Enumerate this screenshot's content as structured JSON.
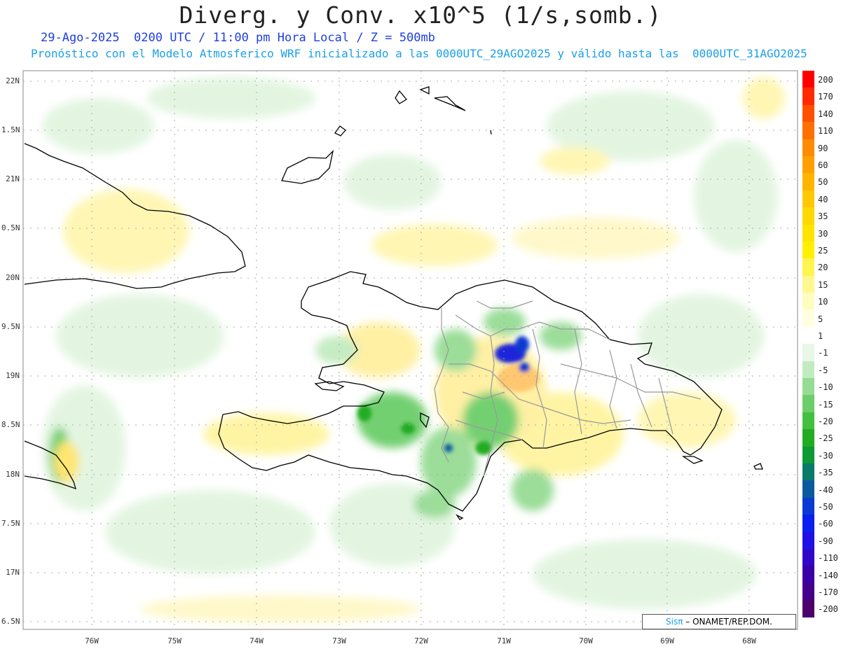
{
  "title": "Diverg. y Conv. x10^5 (1/s,somb.)",
  "subtitle_time": "29-Ago-2025  0200 UTC / 11:00 pm Hora Local / Z = 500mb",
  "subtitle_model": "Pronóstico con el Modelo Atmosferico WRF inicializado a las 0000UTC_29AGO2025 y válido hasta las  0000UTC_31AGO2025",
  "lat_labels": [
    "22N",
    "1.5N",
    "21N",
    "0.5N",
    "20N",
    "9.5N",
    "19N",
    "8.5N",
    "18N",
    "7.5N",
    "17N",
    "6.5N"
  ],
  "lon_labels": [
    "76W",
    "75W",
    "74W",
    "73W",
    "72W",
    "71W",
    "70W",
    "69W",
    "68W"
  ],
  "colorbar": {
    "labels": [
      "200",
      "170",
      "140",
      "110",
      "90",
      "60",
      "50",
      "40",
      "35",
      "30",
      "25",
      "20",
      "15",
      "10",
      "5",
      "1",
      "-1",
      "-5",
      "-10",
      "-15",
      "-20",
      "-25",
      "-30",
      "-35",
      "-40",
      "-50",
      "-60",
      "-90",
      "-110",
      "-140",
      "-170",
      "-200"
    ],
    "colors": [
      "#ff0000",
      "#ff2a00",
      "#ff5000",
      "#ff7000",
      "#ff8c00",
      "#ffa000",
      "#ffb400",
      "#ffc800",
      "#ffd800",
      "#ffe400",
      "#fff000",
      "#fff450",
      "#fff890",
      "#fffcc0",
      "#ffffe0",
      "#ffffff",
      "#e8f7e6",
      "#c2ebc0",
      "#96dc94",
      "#6cce6a",
      "#44c040",
      "#22ac22",
      "#0c9a36",
      "#0a7a6a",
      "#0a5aa0",
      "#0a3ad2",
      "#0a1ef0",
      "#2010e6",
      "#3006c8",
      "#3a00a8",
      "#44008a",
      "#4c006c"
    ]
  },
  "credit": {
    "logo": "Sisπ",
    "text": " – ONAMET/REP.DOM."
  }
}
